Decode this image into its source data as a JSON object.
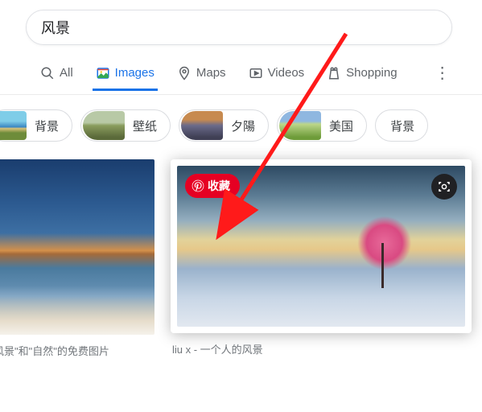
{
  "search": {
    "query": "风景"
  },
  "tabs": {
    "all": "All",
    "images": "Images",
    "maps": "Maps",
    "videos": "Videos",
    "shopping": "Shopping"
  },
  "chips": [
    {
      "label": "背景"
    },
    {
      "label": "壁纸"
    },
    {
      "label": "夕陽"
    },
    {
      "label": "美国"
    },
    {
      "label": "背景"
    }
  ],
  "results": [
    {
      "caption": "风景\"和\"自然\"的免费图片"
    },
    {
      "caption": "liu x - 一个人的风景"
    }
  ],
  "overlay": {
    "pin_label": "收藏"
  }
}
